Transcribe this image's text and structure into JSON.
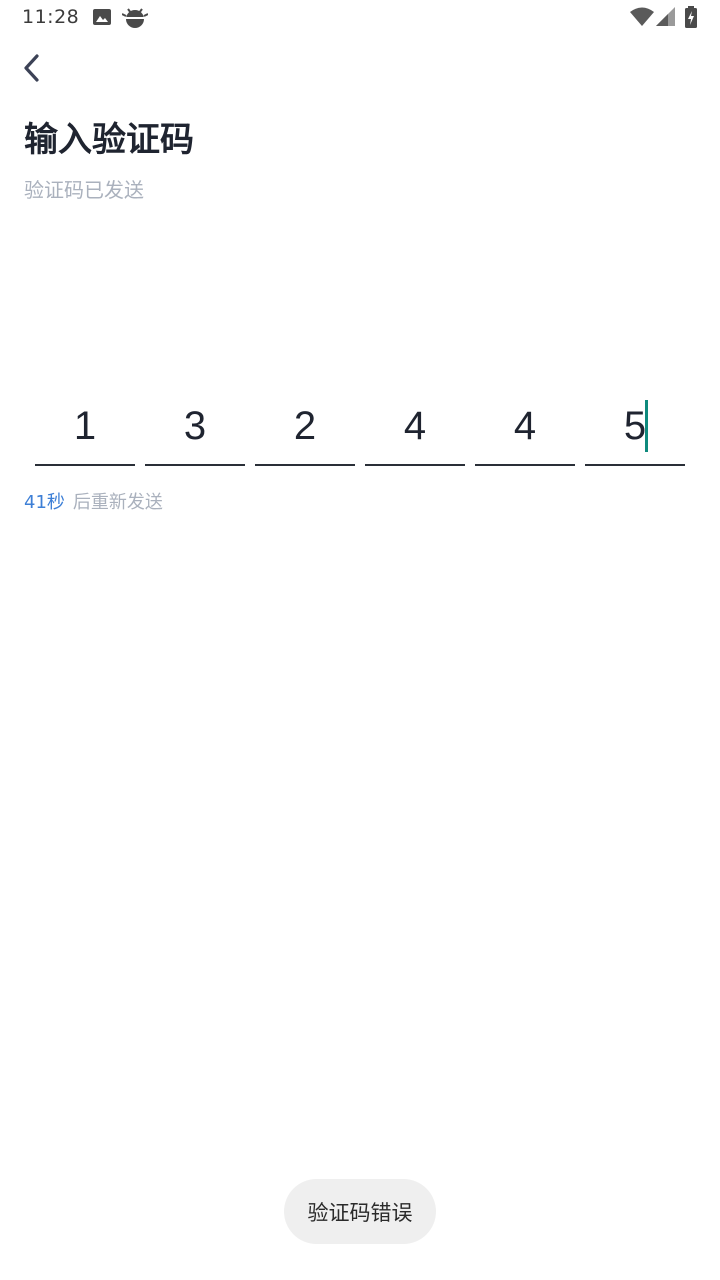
{
  "status_bar": {
    "time": "11:28",
    "icons": [
      "image-icon",
      "android-icon",
      "wifi-icon",
      "signal-icon",
      "battery-charging-icon"
    ]
  },
  "nav": {
    "back_icon": "chevron-left-icon"
  },
  "header": {
    "title": "输入验证码",
    "subtitle": "验证码已发送"
  },
  "code": {
    "digits": [
      "1",
      "3",
      "2",
      "4",
      "4",
      "5"
    ]
  },
  "resend": {
    "seconds": "41秒",
    "label": "后重新发送"
  },
  "toast": {
    "message": "验证码错误"
  },
  "colors": {
    "accent": "#3d7fd6",
    "caret": "#0e8a7d",
    "title": "#1f2430",
    "muted": "#aab1bd",
    "toast_bg": "#efefef"
  }
}
